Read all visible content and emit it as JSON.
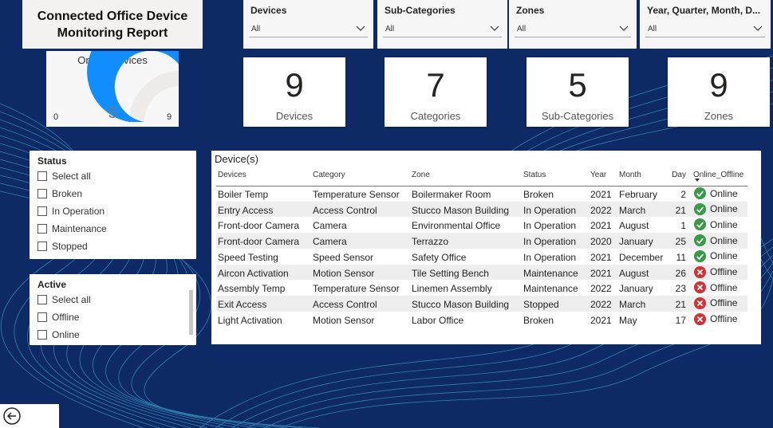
{
  "report_title": "Connected Office Device Monitoring Report",
  "slicers": [
    {
      "title": "Devices",
      "value": "All"
    },
    {
      "title": "Sub-Categories",
      "value": "All"
    },
    {
      "title": "Zones",
      "value": "All"
    },
    {
      "title": "Year, Quarter, Month, D...",
      "value": "All"
    }
  ],
  "gauge": {
    "title": "Online Devices",
    "value": "5",
    "min": "0",
    "max": "9",
    "fill_fraction": 0.5556,
    "color": "#118dff",
    "track_color": "#eeeceb"
  },
  "kpis": [
    {
      "value": "9",
      "label": "Devices"
    },
    {
      "value": "7",
      "label": "Categories"
    },
    {
      "value": "5",
      "label": "Sub-Categories"
    },
    {
      "value": "9",
      "label": "Zones"
    }
  ],
  "status_slicer": {
    "title": "Status",
    "options": [
      "Select all",
      "Broken",
      "In Operation",
      "Maintenance",
      "Stopped"
    ]
  },
  "active_slicer": {
    "title": "Active",
    "options": [
      "Select all",
      "Offline",
      "Online"
    ]
  },
  "table": {
    "title": "Device(s)",
    "columns": [
      "Devices",
      "Category",
      "Zone",
      "Status",
      "Year",
      "Month",
      "Day",
      "Online_Offline"
    ],
    "rows": [
      {
        "device": "Boiler Temp",
        "category": "Temperature Sensor",
        "zone": "Boilermaker Room",
        "status": "Broken",
        "year": "2021",
        "month": "February",
        "day": "2",
        "online": "Online"
      },
      {
        "device": "Entry Access",
        "category": "Access Control",
        "zone": "Stucco Mason Building",
        "status": "In Operation",
        "year": "2022",
        "month": "March",
        "day": "21",
        "online": "Online"
      },
      {
        "device": "Front-door Camera",
        "category": "Camera",
        "zone": "Environmental Office",
        "status": "In Operation",
        "year": "2021",
        "month": "August",
        "day": "1",
        "online": "Online"
      },
      {
        "device": "Front-door Camera",
        "category": "Camera",
        "zone": "Terrazzo",
        "status": "In Operation",
        "year": "2020",
        "month": "January",
        "day": "25",
        "online": "Online"
      },
      {
        "device": "Speed Testing",
        "category": "Speed Sensor",
        "zone": "Safety Office",
        "status": "In Operation",
        "year": "2021",
        "month": "December",
        "day": "11",
        "online": "Online"
      },
      {
        "device": "Aircon Activation",
        "category": "Motion Sensor",
        "zone": "Tile Setting Bench",
        "status": "Maintenance",
        "year": "2021",
        "month": "August",
        "day": "26",
        "online": "Offline"
      },
      {
        "device": "Assembly Temp",
        "category": "Temperature Sensor",
        "zone": "Linemen Assembly",
        "status": "Maintenance",
        "year": "2022",
        "month": "January",
        "day": "23",
        "online": "Offline"
      },
      {
        "device": "Exit Access",
        "category": "Access Control",
        "zone": "Stucco Mason Building",
        "status": "Stopped",
        "year": "2022",
        "month": "March",
        "day": "21",
        "online": "Offline"
      },
      {
        "device": "Light Activation",
        "category": "Motion Sensor",
        "zone": "Labor Office",
        "status": "Broken",
        "year": "2021",
        "month": "May",
        "day": "17",
        "online": "Offline"
      }
    ]
  },
  "colors": {
    "background": "#0e2a66",
    "online": "#3a9a49",
    "offline": "#d13438"
  },
  "icons": {
    "back": "back-arrow-icon",
    "online": "check-circle-icon",
    "offline": "x-circle-icon"
  }
}
